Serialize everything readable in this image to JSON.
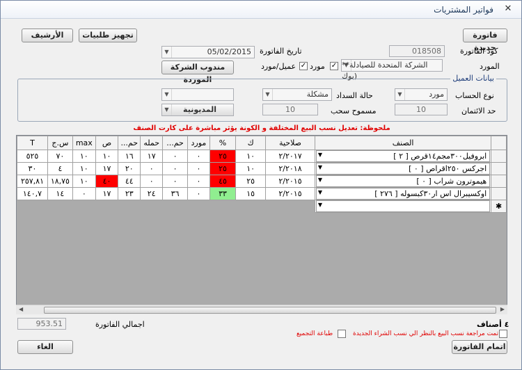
{
  "window": {
    "title": "فواتير المشتريات",
    "close": "✕"
  },
  "top": {
    "new_invoice": "فاتورة جديدة",
    "prepare_orders": "تجهيز طلبيات",
    "archive": "الأرشيف",
    "invoice_code_label": "كود الفاتورة",
    "invoice_code": "018508",
    "invoice_date_label": "تاريخ الفاتورة",
    "invoice_date": "05/02/2015",
    "supplier_label": "المورد",
    "supplier_value": "**الشركة المتحدة للصيادلة (بوك",
    "supplier_chk": "مورد",
    "client_supplier_chk": "عميل/مورد",
    "rep_button": "مندوب الشركة الموردة"
  },
  "client": {
    "group_title": "بيانات العميل",
    "account_type_label": "نوع الحساب",
    "account_type": "مورد",
    "payment_status_label": "حالة السداد",
    "payment_status": "مشكلة",
    "credit_limit_label": "حد الائتمان",
    "credit_limit": "10",
    "draw_allowed_label": "مسموح سحب",
    "draw_allowed": "10",
    "debts_button": "المديونية"
  },
  "note": "ملحوظة: تعديل نسب البيع المختلفة و الكونة يؤثر مباشرة على كارت الصنف",
  "grid": {
    "headers": [
      "الصنف",
      "صلاحية",
      "ك",
      "%",
      "مورد",
      "حم...",
      "حمله",
      "حم...",
      "ص",
      "max",
      "س.ج",
      "T"
    ],
    "rows": [
      {
        "item": "ابروفيل٣٠٠مجم١٤قرص  [  ٢  ]",
        "cells": [
          "٢/٢٠١٧",
          "١٠",
          "٢٥",
          "٠",
          "٠",
          "١٧",
          "١٦",
          "١٠",
          "١٠",
          "٧٠",
          "٥٢٥"
        ]
      },
      {
        "item": "اجركس ٢٥٠اقراص  [  ٠  ]",
        "cells": [
          "٢/٢٠١٨",
          "١٠",
          "٢٥",
          "٠",
          "٠",
          "٠",
          "٢٠",
          "١٧",
          "١٠",
          "٤",
          "٣٠"
        ]
      },
      {
        "item": "هيموترون شراب  [  ٠  ]",
        "cells": [
          "٢/٢٠١٥",
          "٢٥",
          "٤٥",
          "٠",
          "٠",
          "٠",
          "٤٤",
          "٤٠",
          "١٠",
          "١٨,٧٥",
          "٢٥٧,٨١"
        ]
      },
      {
        "item": "اوكسيبرال اس ار٣٠كبسوله  [  ٢٧٦  ]",
        "cells": [
          "٢/٢٠١٥",
          "١٥",
          "٣٣",
          "٠",
          "٣٦",
          "٢٤",
          "٢٣",
          "١٧",
          "٠",
          "١٤",
          "١٤٠,٧"
        ]
      }
    ],
    "new_row_marker": "✱"
  },
  "footer": {
    "items_count": "٤ أصناف",
    "total_label": "اجمالي الفاتورة",
    "total_value": "953.51",
    "review_check": "تمت مراجعة نسب البيع بالنظر الي نسب الشراء الجديدة",
    "print_summary": "طباعة التجميع",
    "finish_button": "اتمام الفاتورة",
    "cancel_button": "الغاء"
  },
  "colors": {
    "red": "#ff0000",
    "green": "#90ee90",
    "title_blue": "#1e395b"
  }
}
